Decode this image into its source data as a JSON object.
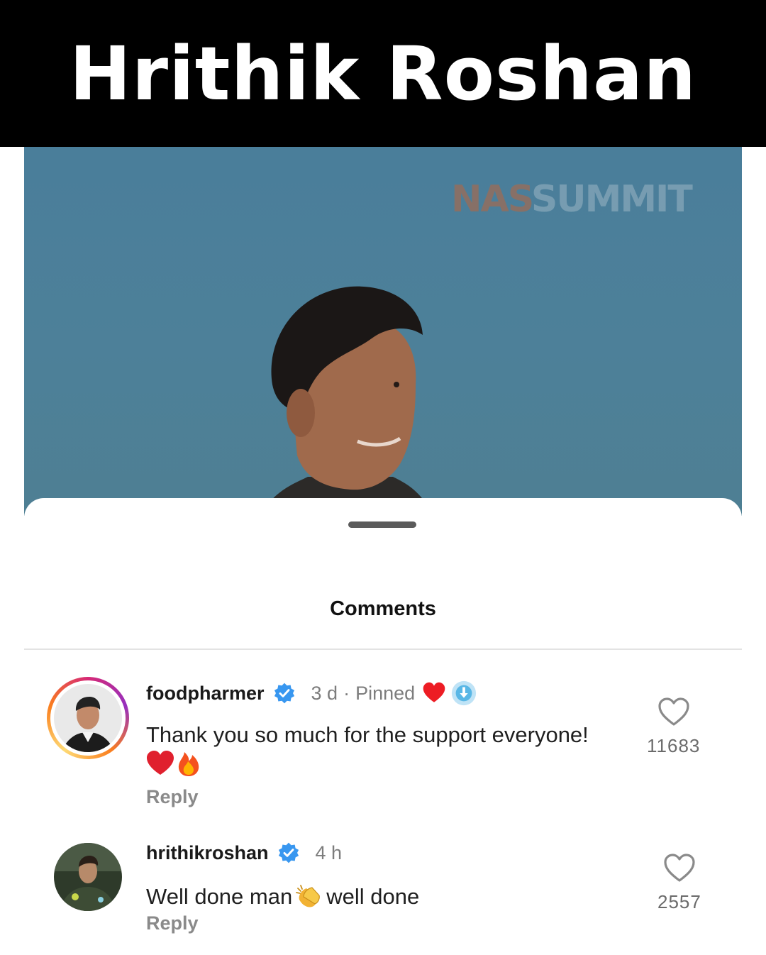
{
  "banner": {
    "title": "Hrithik Roshan"
  },
  "video": {
    "watermark_part1": "NAS",
    "watermark_part2": "SUMMIT"
  },
  "sheet": {
    "title": "Comments"
  },
  "comments": [
    {
      "username": "foodpharmer",
      "verified": true,
      "time": "3 d",
      "separator": "·",
      "pinned": "Pinned",
      "badges": [
        "red-heart-icon",
        "blue-emoji-icon"
      ],
      "text": "Thank you so much for the support everyone!",
      "emojis": [
        "red-heart-emoji",
        "fire-emoji"
      ],
      "reply": "Reply",
      "likes": "11683"
    },
    {
      "username": "hrithikroshan",
      "verified": true,
      "time": "4 h",
      "text_part1": "Well done man",
      "inline_emoji": "clapping-hands-emoji",
      "text_part2": "well done",
      "reply": "Reply",
      "likes": "2557"
    }
  ],
  "colors": {
    "banner_bg": "#000000",
    "video_bg": "#4d8099",
    "verified_blue": "#3897f0",
    "secondary_text": "#7d7d7d"
  }
}
